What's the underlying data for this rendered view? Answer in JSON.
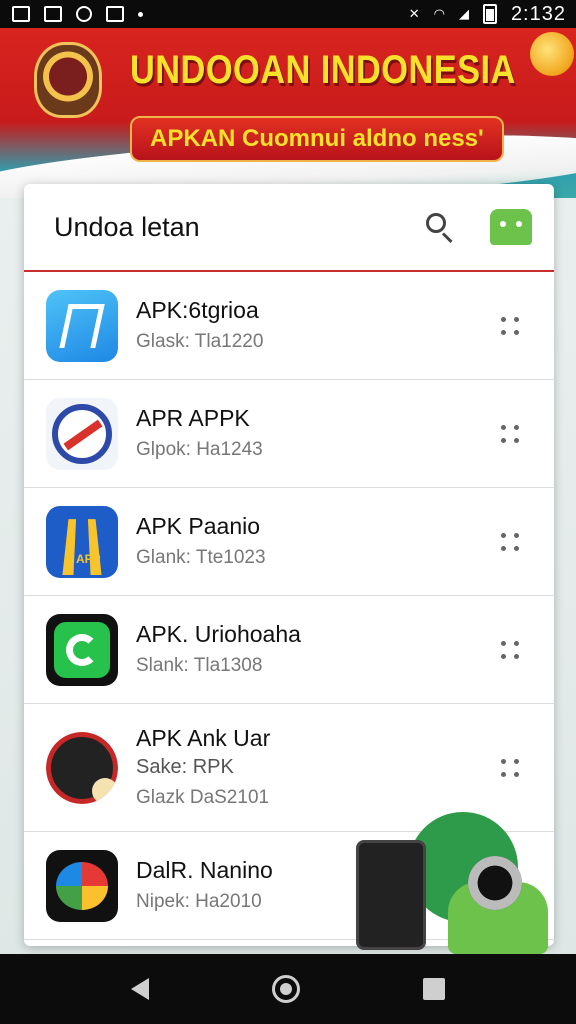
{
  "status_bar": {
    "time": "2:132"
  },
  "banner": {
    "title": "UNDOOAN INDONESIA",
    "subtitle": "APKAN Cuomnui aldno ness'"
  },
  "header": {
    "title": "Undoa letan"
  },
  "apps": [
    {
      "name": "APK:6tgrioa",
      "sub": "",
      "meta": "Glask: Tla1220"
    },
    {
      "name": "APR APPK",
      "sub": "",
      "meta": "Glpok: Ha1243"
    },
    {
      "name": "APK Paanio",
      "sub": "",
      "meta": "Glank: Tte1023"
    },
    {
      "name": "APK. Uriohoaha",
      "sub": "",
      "meta": "Slank: Tla1308"
    },
    {
      "name": "APK Ank Uar",
      "sub": "Sake: RPK",
      "meta": "Glazk DaS2101"
    },
    {
      "name": "DalR. Nanino",
      "sub": "",
      "meta": "Nipek: Ha2010"
    }
  ],
  "icons": {
    "search": "search-icon",
    "android": "android-icon",
    "more": "more-vert-icon",
    "nav_back": "back-icon",
    "nav_home": "home-icon",
    "nav_recent": "recent-apps-icon"
  },
  "colors": {
    "banner_red": "#d8241f",
    "banner_title": "#f7e22b",
    "header_rule": "#c9302c",
    "accent_green": "#6cc24a"
  }
}
